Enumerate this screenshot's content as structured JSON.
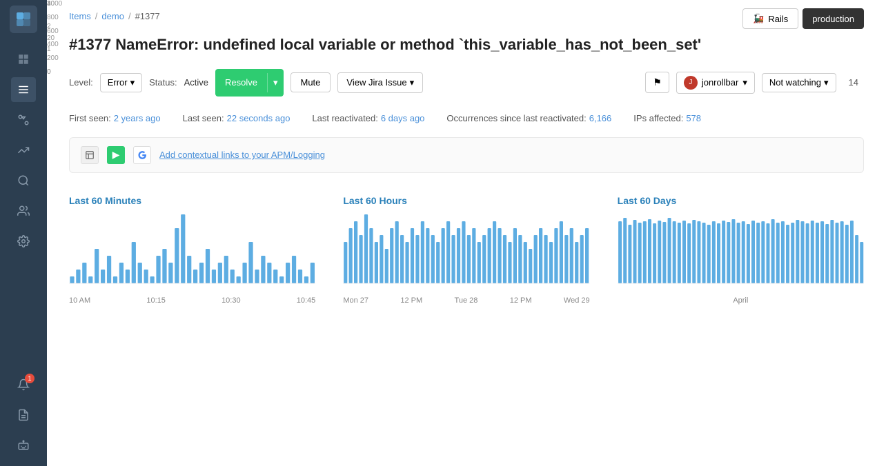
{
  "sidebar": {
    "logo_icon": "chart-icon",
    "nav_items": [
      {
        "name": "dashboard-icon",
        "icon": "📊",
        "active": false
      },
      {
        "name": "items-icon",
        "icon": "≡",
        "active": true
      },
      {
        "name": "versions-icon",
        "icon": "⑂",
        "active": false
      },
      {
        "name": "deploys-icon",
        "icon": "⚑",
        "active": false
      },
      {
        "name": "search-icon",
        "icon": "🔍",
        "active": false
      },
      {
        "name": "people-icon",
        "icon": "👥",
        "active": false
      },
      {
        "name": "settings-icon",
        "icon": "⚙",
        "active": false
      },
      {
        "name": "notifications-icon",
        "icon": "🔔",
        "badge": "1",
        "active": false
      },
      {
        "name": "logs-icon",
        "icon": "📋",
        "active": false
      },
      {
        "name": "bot-icon",
        "icon": "🤖",
        "active": false
      }
    ]
  },
  "breadcrumb": {
    "items_label": "Items",
    "demo_label": "demo",
    "current_label": "#1377"
  },
  "env": {
    "rails_label": "Rails",
    "production_label": "production"
  },
  "error": {
    "title": "#1377 NameError: undefined local variable or method `this_variable_has_not_been_set'"
  },
  "controls": {
    "level_label": "Level:",
    "level_value": "Error",
    "status_label": "Status:",
    "status_value": "Active",
    "resolve_label": "Resolve",
    "mute_label": "Mute",
    "jira_label": "View Jira Issue",
    "user_name": "jonrollbar",
    "watching_label": "Not watching",
    "count": "14"
  },
  "stats": {
    "first_seen_label": "First seen:",
    "first_seen_value": "2 years ago",
    "last_seen_label": "Last seen:",
    "last_seen_value": "22 seconds ago",
    "last_reactivated_label": "Last reactivated:",
    "last_reactivated_value": "6 days ago",
    "occurrences_label": "Occurrences since last reactivated:",
    "occurrences_value": "6,166",
    "ips_label": "IPs affected:",
    "ips_value": "578"
  },
  "integration": {
    "link_text": "Add contextual links to your APM/Logging"
  },
  "charts": {
    "minutes": {
      "title": "Last 60 Minutes",
      "y_labels": [
        "3",
        "2",
        "1",
        "0"
      ],
      "x_labels": [
        "10 AM",
        "10:15",
        "10:30",
        "10:45"
      ],
      "bars": [
        0.1,
        0.2,
        0.3,
        0.1,
        0.5,
        0.2,
        0.4,
        0.1,
        0.3,
        0.2,
        0.6,
        0.3,
        0.2,
        0.1,
        0.4,
        0.5,
        0.3,
        0.8,
        1.0,
        0.4,
        0.2,
        0.3,
        0.5,
        0.2,
        0.3,
        0.4,
        0.2,
        0.1,
        0.3,
        0.6,
        0.2,
        0.4,
        0.3,
        0.2,
        0.1,
        0.3,
        0.4,
        0.2,
        0.1,
        0.3
      ]
    },
    "hours": {
      "title": "Last 60 Hours",
      "y_labels": [
        "40",
        "20",
        "0"
      ],
      "x_labels": [
        "Mon 27",
        "12 PM",
        "Tue 28",
        "12 PM",
        "Wed 29"
      ],
      "bars": [
        0.6,
        0.8,
        0.9,
        0.7,
        1.0,
        0.8,
        0.6,
        0.7,
        0.5,
        0.8,
        0.9,
        0.7,
        0.6,
        0.8,
        0.7,
        0.9,
        0.8,
        0.7,
        0.6,
        0.8,
        0.9,
        0.7,
        0.8,
        0.9,
        0.7,
        0.8,
        0.6,
        0.7,
        0.8,
        0.9,
        0.8,
        0.7,
        0.6,
        0.8,
        0.7,
        0.6,
        0.5,
        0.7,
        0.8,
        0.7,
        0.6,
        0.8,
        0.9,
        0.7,
        0.8,
        0.6,
        0.7,
        0.8
      ]
    },
    "days": {
      "title": "Last 60 Days",
      "y_labels": [
        "1000",
        "800",
        "600",
        "400",
        "200",
        "0"
      ],
      "x_labels": [
        "April"
      ],
      "bars": [
        0.9,
        0.95,
        0.85,
        0.92,
        0.88,
        0.9,
        0.93,
        0.87,
        0.91,
        0.89,
        0.95,
        0.9,
        0.88,
        0.91,
        0.87,
        0.92,
        0.9,
        0.88,
        0.85,
        0.9,
        0.87,
        0.91,
        0.89,
        0.93,
        0.88,
        0.9,
        0.86,
        0.91,
        0.88,
        0.9,
        0.87,
        0.93,
        0.88,
        0.9,
        0.85,
        0.88,
        0.92,
        0.9,
        0.87,
        0.91,
        0.88,
        0.9,
        0.86,
        0.92,
        0.88,
        0.9,
        0.85,
        0.91,
        0.7,
        0.6
      ]
    }
  }
}
